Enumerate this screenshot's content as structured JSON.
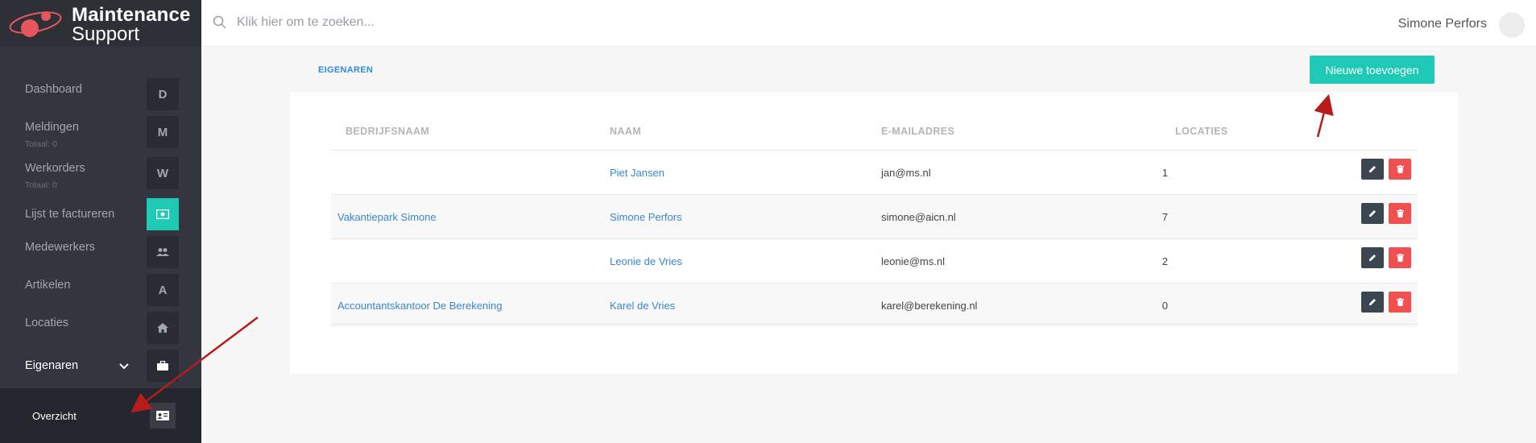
{
  "app": {
    "logo_line1": "Maintenance",
    "logo_line2": "Support",
    "brand_accent": "#1ec9b6"
  },
  "sidebar": {
    "items": [
      {
        "label": "Dashboard",
        "icon": "D"
      },
      {
        "label": "Meldingen",
        "sub": "Totaal: 0",
        "icon": "M"
      },
      {
        "label": "Werkorders",
        "sub": "Totaal: 0",
        "icon": "W"
      },
      {
        "label": "Lijst te factureren",
        "icon": "money-icon"
      },
      {
        "label": "Medewerkers",
        "icon": "users-icon"
      },
      {
        "label": "Artikelen",
        "icon": "A"
      },
      {
        "label": "Locaties",
        "icon": "home-icon"
      },
      {
        "label": "Eigenaren",
        "icon": "briefcase-icon"
      }
    ],
    "subitem": {
      "label": "Overzicht",
      "icon": "id-card-icon"
    }
  },
  "topbar": {
    "search_placeholder": "Klik hier om te zoeken...",
    "user_name": "Simone Perfors"
  },
  "main": {
    "breadcrumb": "EIGENAREN",
    "add_button": "Nieuwe toevoegen",
    "table": {
      "headers": [
        "BEDRIJFSNAAM",
        "NAAM",
        "E-MAILADRES",
        "LOCATIES"
      ],
      "rows": [
        {
          "company": "",
          "name": "Piet Jansen",
          "email": "jan@ms.nl",
          "locations": "1"
        },
        {
          "company": "Vakantiepark Simone",
          "name": "Simone Perfors",
          "email": "simone@aicn.nl",
          "locations": "7"
        },
        {
          "company": "",
          "name": "Leonie de Vries",
          "email": "leonie@ms.nl",
          "locations": "2"
        },
        {
          "company": "Accountantskantoor De Berekening",
          "name": "Karel de Vries",
          "email": "karel@berekening.nl",
          "locations": "0"
        }
      ]
    }
  }
}
